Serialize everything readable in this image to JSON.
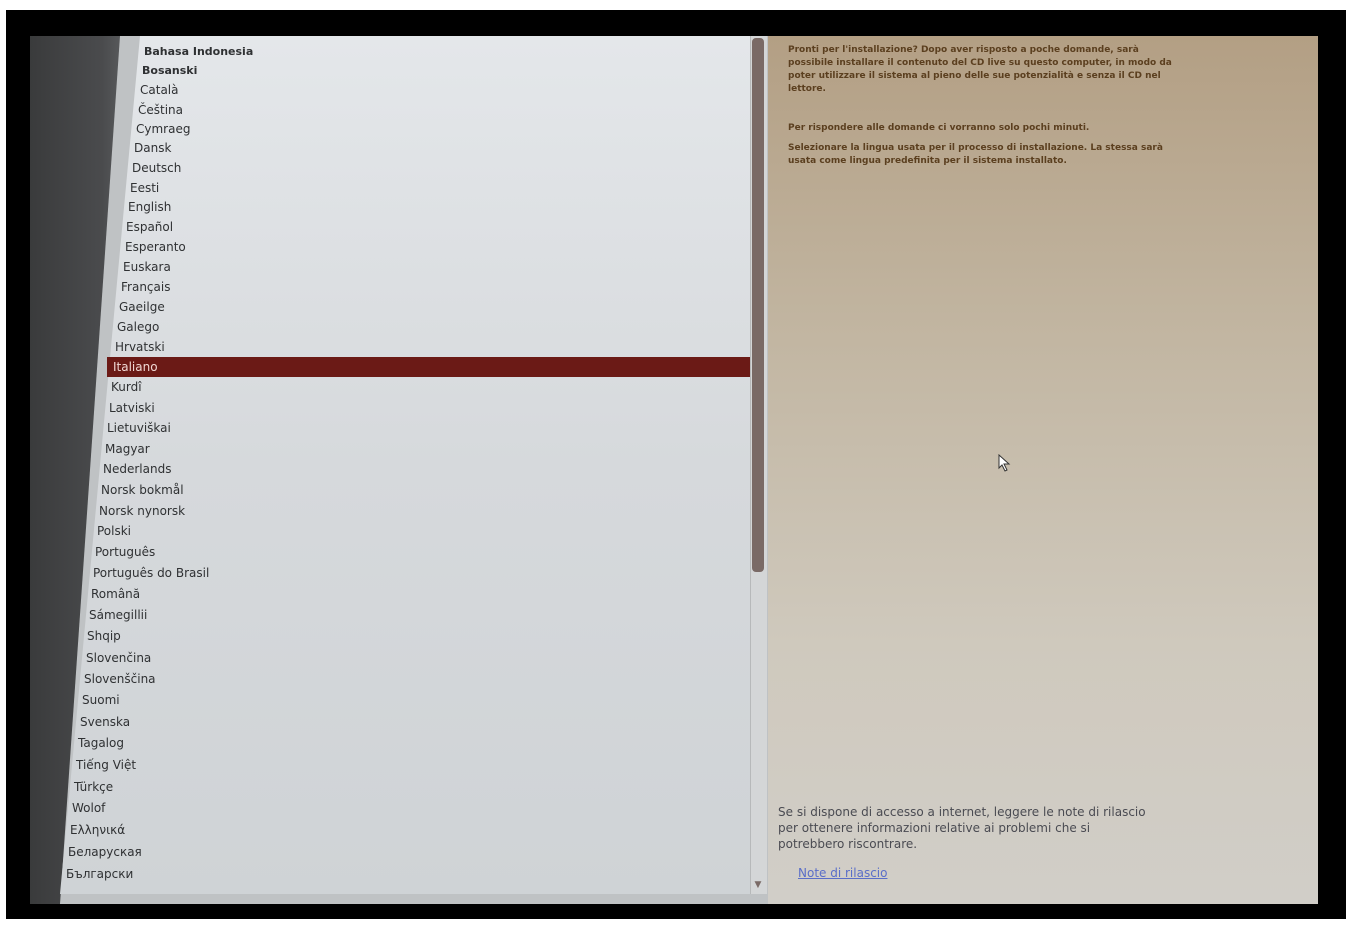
{
  "languages": [
    "Bahasa Indonesia",
    "Bosanski",
    "Català",
    "Čeština",
    "Cymraeg",
    "Dansk",
    "Deutsch",
    "Eesti",
    "English",
    "Español",
    "Esperanto",
    "Euskara",
    "Français",
    "Gaeilge",
    "Galego",
    "Hrvatski",
    "Italiano",
    "Kurdî",
    "Latviski",
    "Lietuviškai",
    "Magyar",
    "Nederlands",
    "Norsk bokmål",
    "Norsk nynorsk",
    "Polski",
    "Português",
    "Português do Brasil",
    "Română",
    "Sámegillii",
    "Shqip",
    "Slovenčina",
    "Slovenščina",
    "Suomi",
    "Svenska",
    "Tagalog",
    "Tiếng Việt",
    "Türkçe",
    "Wolof",
    "Ελληνικά",
    "Беларуская",
    "Български"
  ],
  "selected_language": "Italiano",
  "right_pane": {
    "intro": "Pronti per l'installazione? Dopo aver risposto a poche domande, sarà possibile installare il contenuto del CD live su questo computer, in modo da poter utilizzare il sistema al pieno delle sue potenzialità e senza il CD nel lettore.",
    "duration": "Per rispondere alle domande ci vorranno solo pochi minuti.",
    "select_language": "Selezionare la lingua usata per il processo di installazione. La stessa sarà usata come lingua predefinita per il sistema installato.",
    "release_notes_text": "Se si dispone di accesso a internet, leggere le note di rilascio per ottenere informazioni relative ai problemi che si potrebbero riscontrare.",
    "release_notes_link": "Note di rilascio"
  },
  "colors": {
    "selection": "#6b1a16",
    "link": "#5a6ec8"
  },
  "icons": {
    "cursor": "mouse-pointer-icon",
    "scroll_down": "scroll-down-arrow-icon"
  }
}
